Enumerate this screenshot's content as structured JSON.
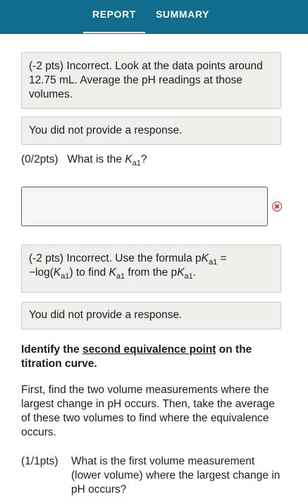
{
  "tabs": {
    "report": "REPORT",
    "summary": "SUMMARY"
  },
  "feedback1": {
    "text": "(-2 pts) Incorrect. Look at the data points around 12.75 mL. Average the pH readings at those volumes."
  },
  "feedback2": {
    "text": "You did not provide a response."
  },
  "question1": {
    "score": "(0/2pts)",
    "prefix": "What is the",
    "symbol": "K",
    "subscript": "a1",
    "suffix": "?"
  },
  "answer1": {
    "value": "",
    "status_icon": "error-circle-x-icon",
    "status_color": "#cc2a2a"
  },
  "feedback3": {
    "part1": "(-2 pts) Incorrect. Use the formula p",
    "k1": "K",
    "s1": "a1",
    "part2": " = −log(",
    "k2": "K",
    "s2": "a1",
    "part3": ") to find ",
    "k3": "K",
    "s3": "a1",
    "part4": " from the p",
    "k4": "K",
    "s4": "a1",
    "part5": "."
  },
  "feedback4": {
    "text": "You did not provide a response."
  },
  "section": {
    "heading_pre": "Identify the ",
    "heading_link": "second equivalence point",
    "heading_post": " on the titration curve.",
    "paragraph": "First, find the two volume measurements where the largest change in pH occurs. Then, take the average of these two volumes to find where the equivalence occurs."
  },
  "question2": {
    "score": "(1/1pts)",
    "text": "What is the first volume measurement (lower volume) where the largest change in pH occurs?"
  },
  "colors": {
    "header_bg": "#106d8d",
    "feedback_bg": "#eef0ec",
    "error": "#cc2a2a"
  }
}
